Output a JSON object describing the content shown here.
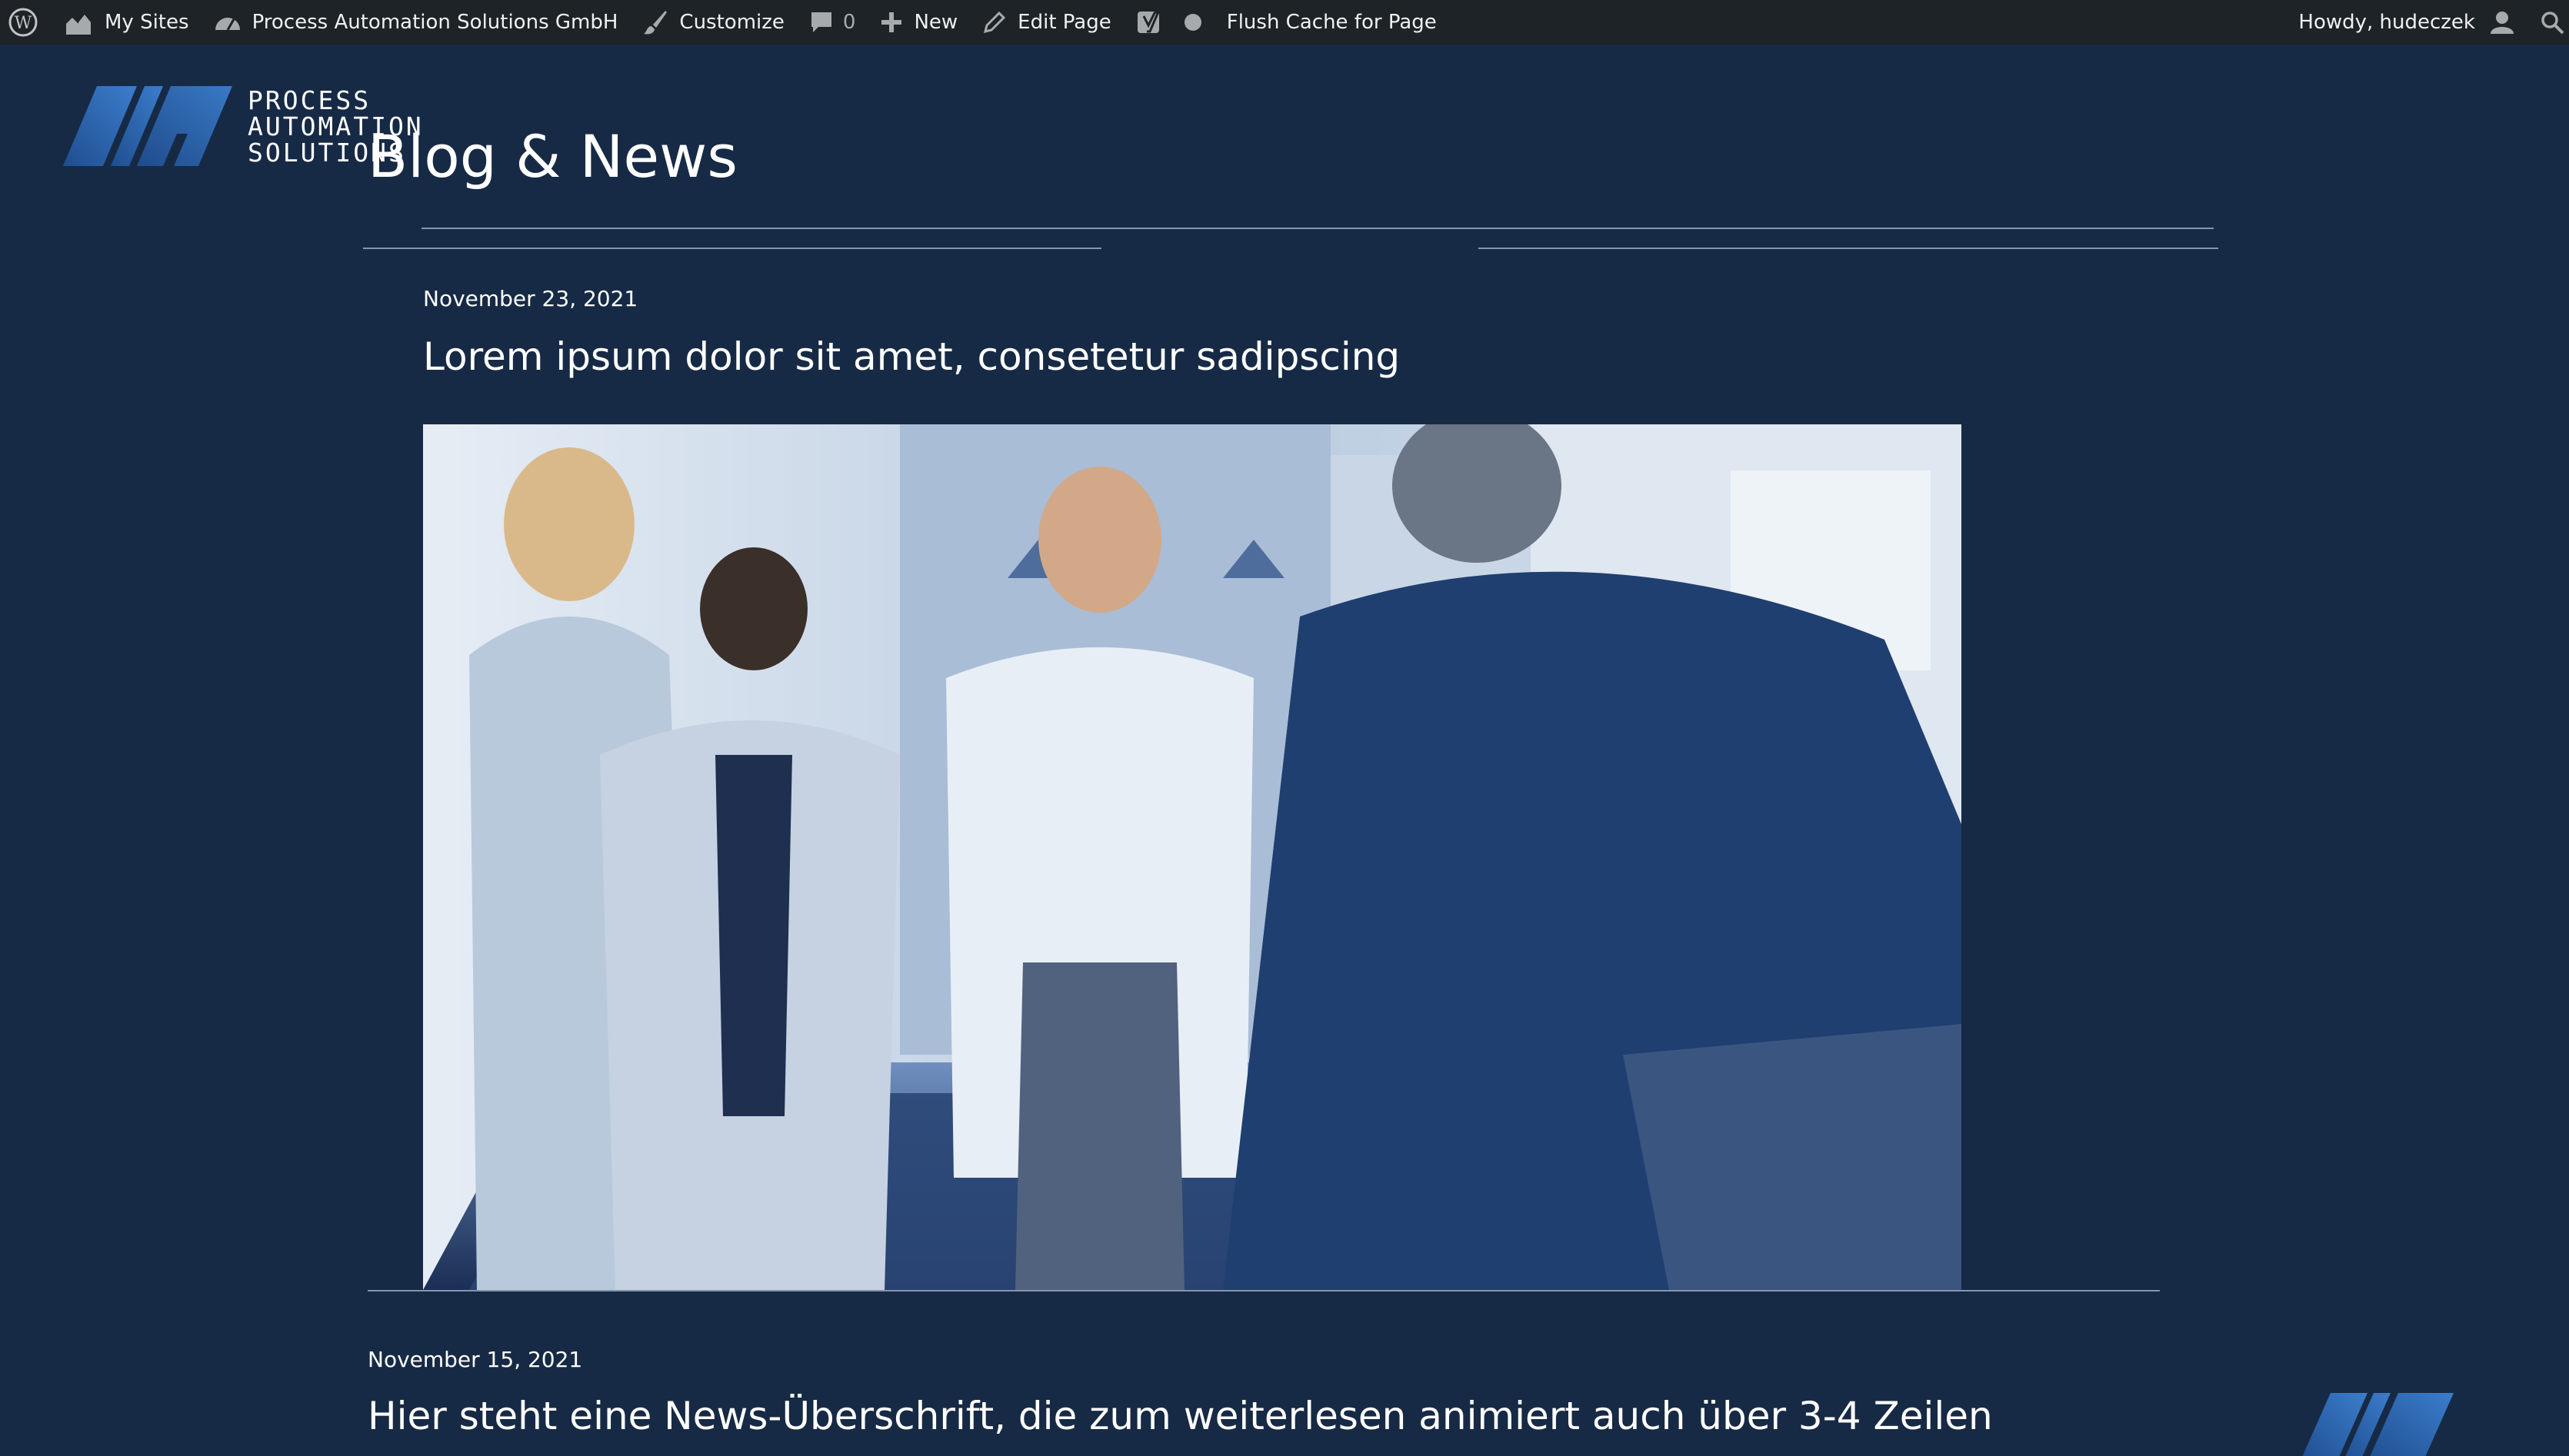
{
  "adminbar": {
    "my_sites": "My Sites",
    "site_name": "Process Automation Solutions GmbH",
    "customize": "Customize",
    "comments_count": "0",
    "new": "New",
    "edit_page": "Edit Page",
    "flush_cache": "Flush Cache for Page",
    "howdy": "Howdy, hudeczek"
  },
  "logo": {
    "line1": "PROCESS",
    "line2": "AUTOMATION",
    "line3": "SOLUTIONS"
  },
  "page": {
    "title": "Blog & News"
  },
  "posts": [
    {
      "date": "November 23, 2021",
      "title": "Lorem ipsum dolor sit amet, consetetur sadipscing"
    },
    {
      "date": "November 15, 2021",
      "title": "Hier steht eine News-Überschrift, die zum weiterlesen animiert auch über 3-4 Zeilen"
    }
  ],
  "colors": {
    "background": "#172a45",
    "adminbar": "#1d2327",
    "logo_blue": "#2f6db5"
  },
  "icons": [
    "wordpress-icon",
    "my-sites-icon",
    "dashboard-icon",
    "brush-icon",
    "comment-icon",
    "plus-icon",
    "pencil-icon",
    "yoast-icon",
    "status-dot-icon",
    "user-icon",
    "search-icon"
  ]
}
